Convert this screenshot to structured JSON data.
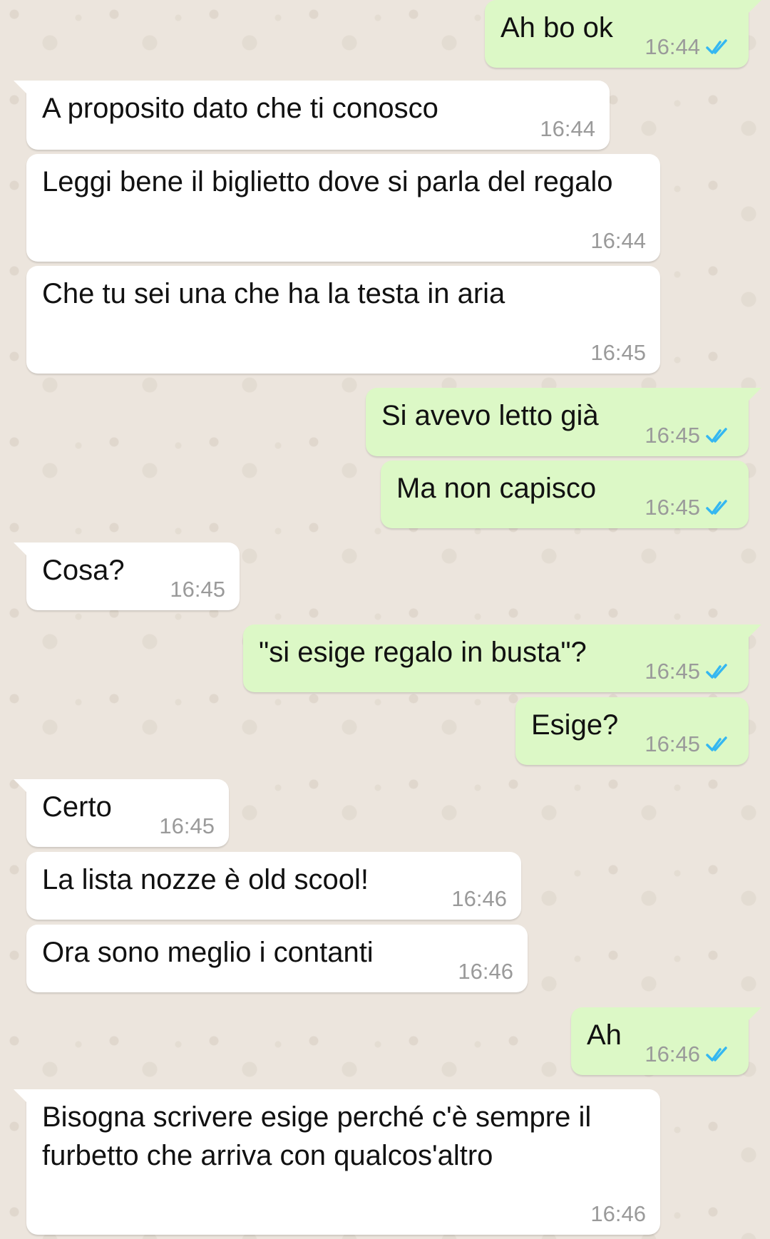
{
  "colors": {
    "background": "#ece5dd",
    "incoming_bubble": "#ffffff",
    "outgoing_bubble": "#dcf8c6",
    "read_ticks": "#34b7f1",
    "timestamp": "#9a9a9a"
  },
  "messages": [
    {
      "direction": "out",
      "text": "Ah bo ok",
      "time": "16:44",
      "status": "read-ticks-icon"
    },
    {
      "direction": "in",
      "text": "A proposito dato che ti conosco",
      "time": "16:44"
    },
    {
      "direction": "in",
      "text": "Leggi bene il biglietto dove si parla del regalo",
      "time": "16:44"
    },
    {
      "direction": "in",
      "text": "Che tu sei una che ha la testa in aria",
      "time": "16:45"
    },
    {
      "direction": "out",
      "text": "Si avevo letto già",
      "time": "16:45",
      "status": "read-ticks-icon"
    },
    {
      "direction": "out",
      "text": "Ma non capisco",
      "time": "16:45",
      "status": "read-ticks-icon"
    },
    {
      "direction": "in",
      "text": "Cosa?",
      "time": "16:45"
    },
    {
      "direction": "out",
      "text": "\"si esige regalo in busta\"?",
      "time": "16:45",
      "status": "read-ticks-icon"
    },
    {
      "direction": "out",
      "text": "Esige?",
      "time": "16:45",
      "status": "read-ticks-icon"
    },
    {
      "direction": "in",
      "text": "Certo",
      "time": "16:45"
    },
    {
      "direction": "in",
      "text": "La lista nozze è old scool!",
      "time": "16:46"
    },
    {
      "direction": "in",
      "text": "Ora sono meglio i contanti",
      "time": "16:46"
    },
    {
      "direction": "out",
      "text": "Ah",
      "time": "16:46",
      "status": "read-ticks-icon"
    },
    {
      "direction": "in",
      "text": "Bisogna scrivere esige perché c'è sempre il furbetto che arriva con qualcos'altro",
      "time": "16:46"
    }
  ]
}
